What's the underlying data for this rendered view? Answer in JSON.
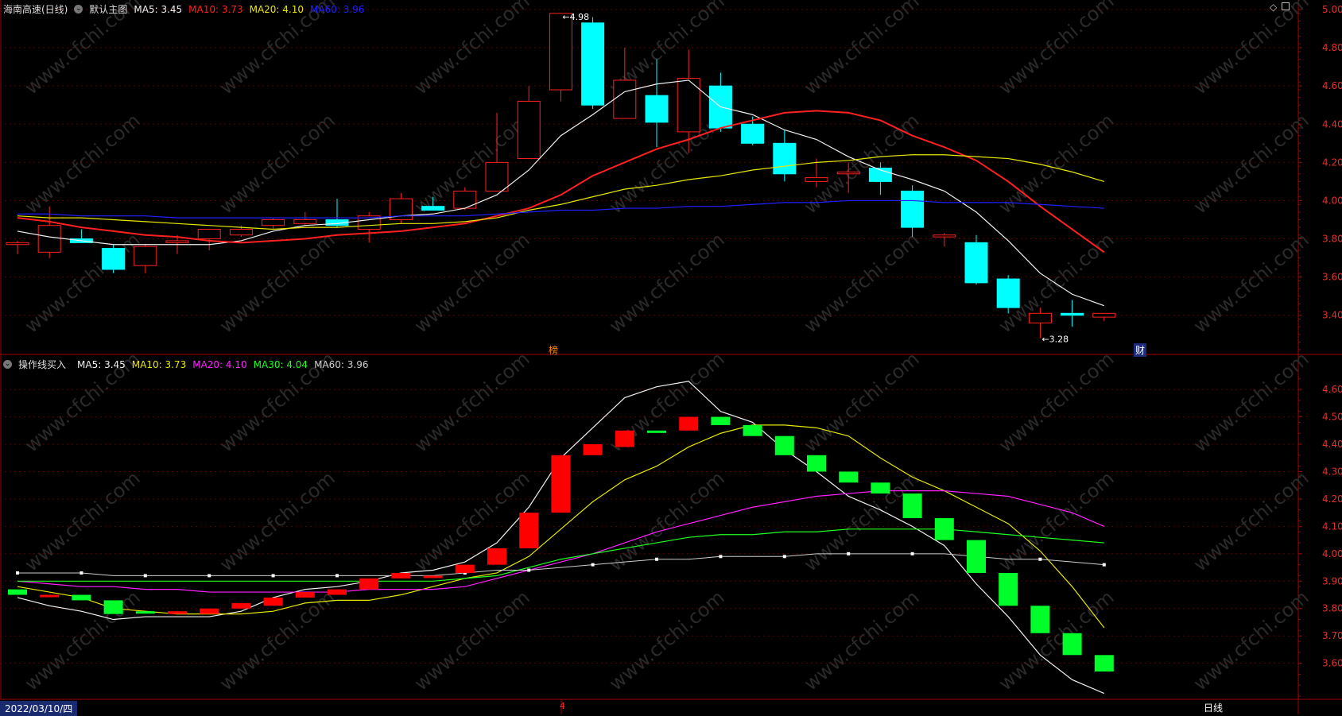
{
  "upper_header": {
    "stock": "海南高速(日线)",
    "template": "默认主图",
    "ma5": "MA5: 3.45",
    "ma10": "MA10: 3.73",
    "ma20": "MA20: 4.10",
    "ma60": "MA60: 3.96"
  },
  "lower_header": {
    "indicator": "操作线买入",
    "ma5": "MA5: 3.45",
    "ma10": "MA10: 3.73",
    "ma20": "MA20: 4.10",
    "ma30": "MA30: 4.04",
    "ma60": "MA60: 3.96"
  },
  "footer": {
    "date": "2022/03/10/四",
    "period": "日线",
    "month_mark": "4"
  },
  "markers": {
    "bang": "榜",
    "cai": "财"
  },
  "watermark": "www.cfchi.com",
  "colors": {
    "up": "#ff2020",
    "down": "#00ffff",
    "up2": "#ff0000",
    "down2": "#00ff2a",
    "grid": "#5a0000",
    "axis": "#a00000"
  },
  "chart_data": [
    {
      "type": "candlestick",
      "title": "海南高速(日线)",
      "ylim": [
        3.22,
        5.0
      ],
      "yticks": [
        "5.00",
        "4.80",
        "4.60",
        "4.40",
        "4.20",
        "4.00",
        "3.80",
        "3.60",
        "3.40"
      ],
      "max_label": "4.98",
      "min_label": "3.28",
      "candles": [
        {
          "o": 3.77,
          "h": 3.79,
          "l": 3.72,
          "c": 3.78
        },
        {
          "o": 3.73,
          "h": 3.97,
          "l": 3.7,
          "c": 3.87
        },
        {
          "o": 3.8,
          "h": 3.85,
          "l": 3.78,
          "c": 3.78
        },
        {
          "o": 3.75,
          "h": 3.77,
          "l": 3.62,
          "c": 3.64
        },
        {
          "o": 3.66,
          "h": 3.77,
          "l": 3.62,
          "c": 3.76
        },
        {
          "o": 3.78,
          "h": 3.82,
          "l": 3.72,
          "c": 3.79
        },
        {
          "o": 3.8,
          "h": 3.85,
          "l": 3.74,
          "c": 3.85
        },
        {
          "o": 3.82,
          "h": 3.87,
          "l": 3.81,
          "c": 3.85
        },
        {
          "o": 3.87,
          "h": 3.91,
          "l": 3.85,
          "c": 3.9
        },
        {
          "o": 3.88,
          "h": 3.94,
          "l": 3.87,
          "c": 3.9
        },
        {
          "o": 3.9,
          "h": 4.01,
          "l": 3.86,
          "c": 3.87
        },
        {
          "o": 3.85,
          "h": 3.94,
          "l": 3.78,
          "c": 3.92
        },
        {
          "o": 3.9,
          "h": 4.04,
          "l": 3.88,
          "c": 4.01
        },
        {
          "o": 3.97,
          "h": 4.02,
          "l": 3.95,
          "c": 3.95
        },
        {
          "o": 3.96,
          "h": 4.07,
          "l": 3.95,
          "c": 4.05
        },
        {
          "o": 4.05,
          "h": 4.46,
          "l": 4.05,
          "c": 4.2
        },
        {
          "o": 4.22,
          "h": 4.6,
          "l": 4.22,
          "c": 4.52
        },
        {
          "o": 4.58,
          "h": 4.98,
          "l": 4.52,
          "c": 4.98
        },
        {
          "o": 4.93,
          "h": 4.96,
          "l": 4.48,
          "c": 4.5
        },
        {
          "o": 4.43,
          "h": 4.8,
          "l": 4.43,
          "c": 4.63
        },
        {
          "o": 4.55,
          "h": 4.74,
          "l": 4.28,
          "c": 4.41
        },
        {
          "o": 4.36,
          "h": 4.79,
          "l": 4.25,
          "c": 4.64
        },
        {
          "o": 4.6,
          "h": 4.67,
          "l": 4.36,
          "c": 4.38
        },
        {
          "o": 4.4,
          "h": 4.44,
          "l": 4.29,
          "c": 4.3
        },
        {
          "o": 4.3,
          "h": 4.37,
          "l": 4.1,
          "c": 4.14
        },
        {
          "o": 4.1,
          "h": 4.22,
          "l": 4.07,
          "c": 4.12
        },
        {
          "o": 4.14,
          "h": 4.2,
          "l": 4.04,
          "c": 4.15
        },
        {
          "o": 4.17,
          "h": 4.2,
          "l": 4.03,
          "c": 4.1
        },
        {
          "o": 4.05,
          "h": 4.08,
          "l": 3.81,
          "c": 3.86
        },
        {
          "o": 3.81,
          "h": 3.83,
          "l": 3.76,
          "c": 3.82
        },
        {
          "o": 3.78,
          "h": 3.82,
          "l": 3.56,
          "c": 3.57
        },
        {
          "o": 3.59,
          "h": 3.61,
          "l": 3.41,
          "c": 3.44
        },
        {
          "o": 3.36,
          "h": 3.44,
          "l": 3.28,
          "c": 3.41
        },
        {
          "o": 3.41,
          "h": 3.48,
          "l": 3.34,
          "c": 3.4
        },
        {
          "o": 3.39,
          "h": 3.41,
          "l": 3.37,
          "c": 3.41
        }
      ],
      "series": [
        {
          "name": "MA5",
          "color": "#f0f0f0",
          "values": [
            3.84,
            3.81,
            3.79,
            3.77,
            3.77,
            3.77,
            3.77,
            3.79,
            3.84,
            3.87,
            3.88,
            3.9,
            3.92,
            3.93,
            3.96,
            4.03,
            4.16,
            4.34,
            4.45,
            4.57,
            4.61,
            4.63,
            4.49,
            4.45,
            4.37,
            4.32,
            4.23,
            4.16,
            4.11,
            4.05,
            3.94,
            3.79,
            3.62,
            3.51,
            3.45
          ]
        },
        {
          "name": "MA10",
          "color": "#ff2020",
          "values": [
            3.91,
            3.89,
            3.86,
            3.84,
            3.82,
            3.81,
            3.79,
            3.78,
            3.79,
            3.8,
            3.82,
            3.83,
            3.84,
            3.86,
            3.88,
            3.92,
            3.96,
            4.03,
            4.13,
            4.2,
            4.27,
            4.32,
            4.38,
            4.42,
            4.46,
            4.47,
            4.46,
            4.42,
            4.34,
            4.28,
            4.21,
            4.1,
            3.97,
            3.85,
            3.73
          ]
        },
        {
          "name": "MA20",
          "color": "#e8e800",
          "values": [
            3.92,
            3.91,
            3.91,
            3.9,
            3.89,
            3.88,
            3.87,
            3.86,
            3.85,
            3.86,
            3.86,
            3.87,
            3.88,
            3.88,
            3.89,
            3.91,
            3.95,
            3.98,
            4.02,
            4.06,
            4.08,
            4.11,
            4.13,
            4.16,
            4.18,
            4.2,
            4.21,
            4.23,
            4.24,
            4.24,
            4.23,
            4.22,
            4.19,
            4.15,
            4.1
          ]
        },
        {
          "name": "MA60",
          "color": "#2020ff",
          "values": [
            3.93,
            3.93,
            3.92,
            3.92,
            3.92,
            3.91,
            3.91,
            3.91,
            3.91,
            3.91,
            3.91,
            3.91,
            3.92,
            3.92,
            3.92,
            3.93,
            3.94,
            3.95,
            3.95,
            3.96,
            3.96,
            3.97,
            3.97,
            3.98,
            3.99,
            3.99,
            4.0,
            4.0,
            4.0,
            3.99,
            3.99,
            3.99,
            3.98,
            3.97,
            3.96
          ]
        }
      ]
    },
    {
      "type": "bar",
      "title": "操作线买入",
      "ylim": [
        3.48,
        4.67
      ],
      "yticks": [
        "4.60",
        "4.50",
        "4.40",
        "4.30",
        "4.20",
        "4.10",
        "4.00",
        "3.90",
        "3.80",
        "3.70",
        "3.60"
      ],
      "bars": [
        {
          "o": 3.87,
          "c": 3.85,
          "up": false
        },
        {
          "o": 3.85,
          "c": 3.85,
          "up": true
        },
        {
          "o": 3.85,
          "c": 3.83,
          "up": false
        },
        {
          "o": 3.83,
          "c": 3.78,
          "up": false
        },
        {
          "o": 3.79,
          "c": 3.79,
          "up": false
        },
        {
          "o": 3.78,
          "c": 3.79,
          "up": true
        },
        {
          "o": 3.78,
          "c": 3.8,
          "up": true
        },
        {
          "o": 3.8,
          "c": 3.82,
          "up": true
        },
        {
          "o": 3.81,
          "c": 3.84,
          "up": true
        },
        {
          "o": 3.84,
          "c": 3.86,
          "up": true
        },
        {
          "o": 3.85,
          "c": 3.87,
          "up": true
        },
        {
          "o": 3.87,
          "c": 3.91,
          "up": true
        },
        {
          "o": 3.91,
          "c": 3.93,
          "up": true
        },
        {
          "o": 3.92,
          "c": 3.92,
          "up": true
        },
        {
          "o": 3.93,
          "c": 3.96,
          "up": true
        },
        {
          "o": 3.96,
          "c": 4.02,
          "up": true
        },
        {
          "o": 4.02,
          "c": 4.15,
          "up": true
        },
        {
          "o": 4.15,
          "c": 4.36,
          "up": true
        },
        {
          "o": 4.36,
          "c": 4.4,
          "up": true
        },
        {
          "o": 4.39,
          "c": 4.45,
          "up": true
        },
        {
          "o": 4.45,
          "c": 4.45,
          "up": false
        },
        {
          "o": 4.45,
          "c": 4.5,
          "up": true
        },
        {
          "o": 4.5,
          "c": 4.47,
          "up": false
        },
        {
          "o": 4.47,
          "c": 4.43,
          "up": false
        },
        {
          "o": 4.43,
          "c": 4.36,
          "up": false
        },
        {
          "o": 4.36,
          "c": 4.3,
          "up": false
        },
        {
          "o": 4.3,
          "c": 4.26,
          "up": false
        },
        {
          "o": 4.26,
          "c": 4.22,
          "up": false
        },
        {
          "o": 4.22,
          "c": 4.13,
          "up": false
        },
        {
          "o": 4.13,
          "c": 4.05,
          "up": false
        },
        {
          "o": 4.05,
          "c": 3.93,
          "up": false
        },
        {
          "o": 3.93,
          "c": 3.81,
          "up": false
        },
        {
          "o": 3.81,
          "c": 3.71,
          "up": false
        },
        {
          "o": 3.71,
          "c": 3.63,
          "up": false
        },
        {
          "o": 3.63,
          "c": 3.57,
          "up": false
        }
      ],
      "series": [
        {
          "name": "MA5",
          "color": "#f0f0f0",
          "values": [
            3.84,
            3.81,
            3.79,
            3.76,
            3.77,
            3.77,
            3.77,
            3.79,
            3.84,
            3.87,
            3.88,
            3.9,
            3.93,
            3.94,
            3.97,
            4.04,
            4.17,
            4.35,
            4.46,
            4.57,
            4.61,
            4.63,
            4.52,
            4.48,
            4.38,
            4.3,
            4.21,
            4.16,
            4.1,
            4.03,
            3.89,
            3.77,
            3.63,
            3.54,
            3.49
          ]
        },
        {
          "name": "MA10",
          "color": "#e8e800",
          "values": [
            3.88,
            3.86,
            3.84,
            3.8,
            3.79,
            3.78,
            3.78,
            3.78,
            3.79,
            3.82,
            3.83,
            3.83,
            3.85,
            3.88,
            3.91,
            3.93,
            3.99,
            4.09,
            4.19,
            4.27,
            4.32,
            4.39,
            4.44,
            4.47,
            4.47,
            4.46,
            4.43,
            4.35,
            4.28,
            4.23,
            4.17,
            4.11,
            4.01,
            3.88,
            3.73
          ]
        },
        {
          "name": "MA20",
          "color": "#ff20ff",
          "values": [
            3.9,
            3.89,
            3.88,
            3.88,
            3.87,
            3.87,
            3.86,
            3.86,
            3.86,
            3.86,
            3.86,
            3.87,
            3.87,
            3.87,
            3.88,
            3.91,
            3.94,
            3.97,
            4.0,
            4.04,
            4.08,
            4.11,
            4.14,
            4.17,
            4.19,
            4.21,
            4.22,
            4.23,
            4.23,
            4.23,
            4.22,
            4.21,
            4.18,
            4.15,
            4.1
          ]
        },
        {
          "name": "MA30",
          "color": "#20ff20",
          "values": [
            3.9,
            3.9,
            3.9,
            3.9,
            3.9,
            3.9,
            3.9,
            3.9,
            3.9,
            3.9,
            3.9,
            3.9,
            3.9,
            3.9,
            3.91,
            3.92,
            3.95,
            3.98,
            4.0,
            4.02,
            4.04,
            4.06,
            4.07,
            4.07,
            4.08,
            4.08,
            4.09,
            4.09,
            4.09,
            4.09,
            4.08,
            4.07,
            4.06,
            4.05,
            4.04
          ]
        },
        {
          "name": "MA60",
          "color": "#ffffff",
          "values": [
            3.93,
            3.93,
            3.93,
            3.92,
            3.92,
            3.92,
            3.92,
            3.92,
            3.92,
            3.92,
            3.92,
            3.92,
            3.92,
            3.92,
            3.93,
            3.94,
            3.94,
            3.95,
            3.96,
            3.97,
            3.98,
            3.98,
            3.99,
            3.99,
            3.99,
            4.0,
            4.0,
            4.0,
            4.0,
            4.0,
            3.99,
            3.98,
            3.98,
            3.97,
            3.96
          ],
          "dotted": true
        }
      ]
    }
  ]
}
